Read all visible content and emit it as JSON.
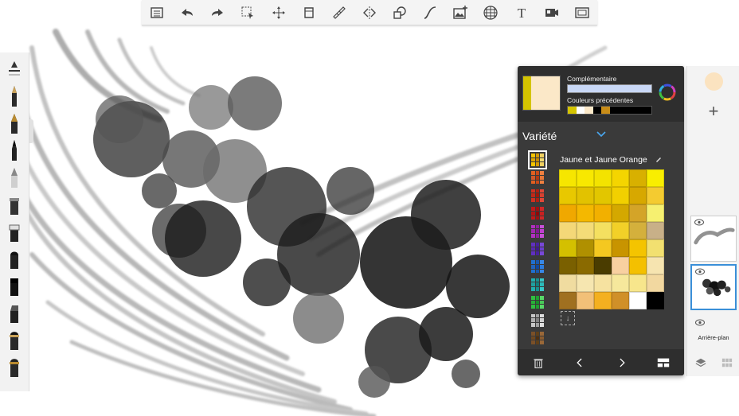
{
  "toolbar": {
    "icons": [
      "list-icon",
      "undo-icon",
      "redo-icon",
      "select-icon",
      "move-icon",
      "fill-icon",
      "ruler-icon",
      "symmetry-icon",
      "shapes-icon",
      "curve-icon",
      "image-icon",
      "perspective-icon",
      "text-icon",
      "video-icon",
      "fullscreen-icon"
    ]
  },
  "left_bar": {
    "brushes": [
      "slider",
      "pen",
      "calligraphy",
      "marker-fine",
      "pencil",
      "airbrush",
      "roller",
      "brush-round",
      "brush-flat",
      "chisel",
      "brush-wide",
      "brush-tip"
    ]
  },
  "color_panel": {
    "current_color": "#fbe8c8",
    "complementary_label": "Complémentaire",
    "complementary_color": "#c9d8f6",
    "previous_label": "Couleurs précédentes",
    "previous_colors": [
      "#d4c400",
      "#ffffff",
      "#fbe8c8",
      "#000000",
      "#c98d18",
      "#000000",
      "#000000",
      "#000000",
      "#000000",
      "#000000"
    ],
    "variety_label": "Variété",
    "palette_name": "Jaune et Jaune Orange",
    "palette_thumbs": [
      [
        "#f5c400",
        "#d49a00",
        "#f0d060",
        "#e0a800",
        "#c88a00",
        "#f6dd70",
        "#f5c400",
        "#d49a00",
        "#f0d060"
      ],
      [
        "#e06020",
        "#c84818",
        "#f08040",
        "#d05828",
        "#b03810",
        "#e87838",
        "#e06020",
        "#c84818",
        "#f08040"
      ],
      [
        "#d03020",
        "#b02010",
        "#e04838",
        "#c02818",
        "#a01808",
        "#d84030",
        "#d03020",
        "#b02010",
        "#e04838"
      ],
      [
        "#c01818",
        "#a01010",
        "#d02828",
        "#b01414",
        "#900808",
        "#c82020",
        "#c01818",
        "#a01010",
        "#d02828"
      ],
      [
        "#b030c0",
        "#9020a0",
        "#c850d8",
        "#a028b0",
        "#801890",
        "#c040d0",
        "#b030c0",
        "#9020a0",
        "#c850d8"
      ],
      [
        "#6030c0",
        "#4820a0",
        "#7848d8",
        "#5828b0",
        "#401890",
        "#6c40d0",
        "#6030c0",
        "#4820a0",
        "#7848d8"
      ],
      [
        "#2070d0",
        "#1858b0",
        "#3888e8",
        "#2064c0",
        "#1048a0",
        "#2c7ce0",
        "#2070d0",
        "#1858b0",
        "#3888e8"
      ],
      [
        "#20b0b0",
        "#189090",
        "#38c8c8",
        "#20a0a0",
        "#108080",
        "#2cbcbc",
        "#20b0b0",
        "#189090",
        "#38c8c8"
      ],
      [
        "#30c040",
        "#20a030",
        "#58d868",
        "#28b038",
        "#189028",
        "#48c858",
        "#30c040",
        "#20a030",
        "#58d868"
      ],
      [
        "#c8c8c8",
        "#a0a0a0",
        "#e0e0e0",
        "#b0b0b0",
        "#808080",
        "#d0d0d0",
        "#c8c8c8",
        "#a0a0a0",
        "#e0e0e0"
      ],
      [
        "#7a5028",
        "#604018",
        "#9a6838",
        "#6e4820",
        "#503010",
        "#8a5c30",
        "#7a5028",
        "#604018",
        "#9a6838"
      ]
    ],
    "swatches": [
      "#f6e600",
      "#f8e800",
      "#f3e300",
      "#f4d500",
      "#d8b000",
      "#f9ee00",
      "#e8c800",
      "#e2c200",
      "#e2c600",
      "#f2d000",
      "#d7a800",
      "#f4cb30",
      "#f0a800",
      "#f4b800",
      "#f2b000",
      "#d4a800",
      "#d4a428",
      "#f6f070",
      "#f4d878",
      "#f4dc78",
      "#f4e060",
      "#f2d028",
      "#d4b03c",
      "#c8b088",
      "#d4c000",
      "#b09000",
      "#f4c820",
      "#c89400",
      "#f4c400",
      "#f2e070",
      "#7a6000",
      "#8a6a00",
      "#4a3c00",
      "#f8d0a0",
      "#f4c000",
      "#f6e4b0",
      "#f0dca0",
      "#f6e6b0",
      "#f6e2a0",
      "#f6e89c",
      "#f7e68c",
      "#f2d8a0",
      "#a07020",
      "#f2c078",
      "#f4b020",
      "#d09028",
      "#ffffff",
      "#000000"
    ],
    "add_swatch_glyph": "↓"
  },
  "layers": {
    "current_color": "#fbe3c0",
    "add_glyph": "+",
    "background_label": "Arrière-plan"
  }
}
